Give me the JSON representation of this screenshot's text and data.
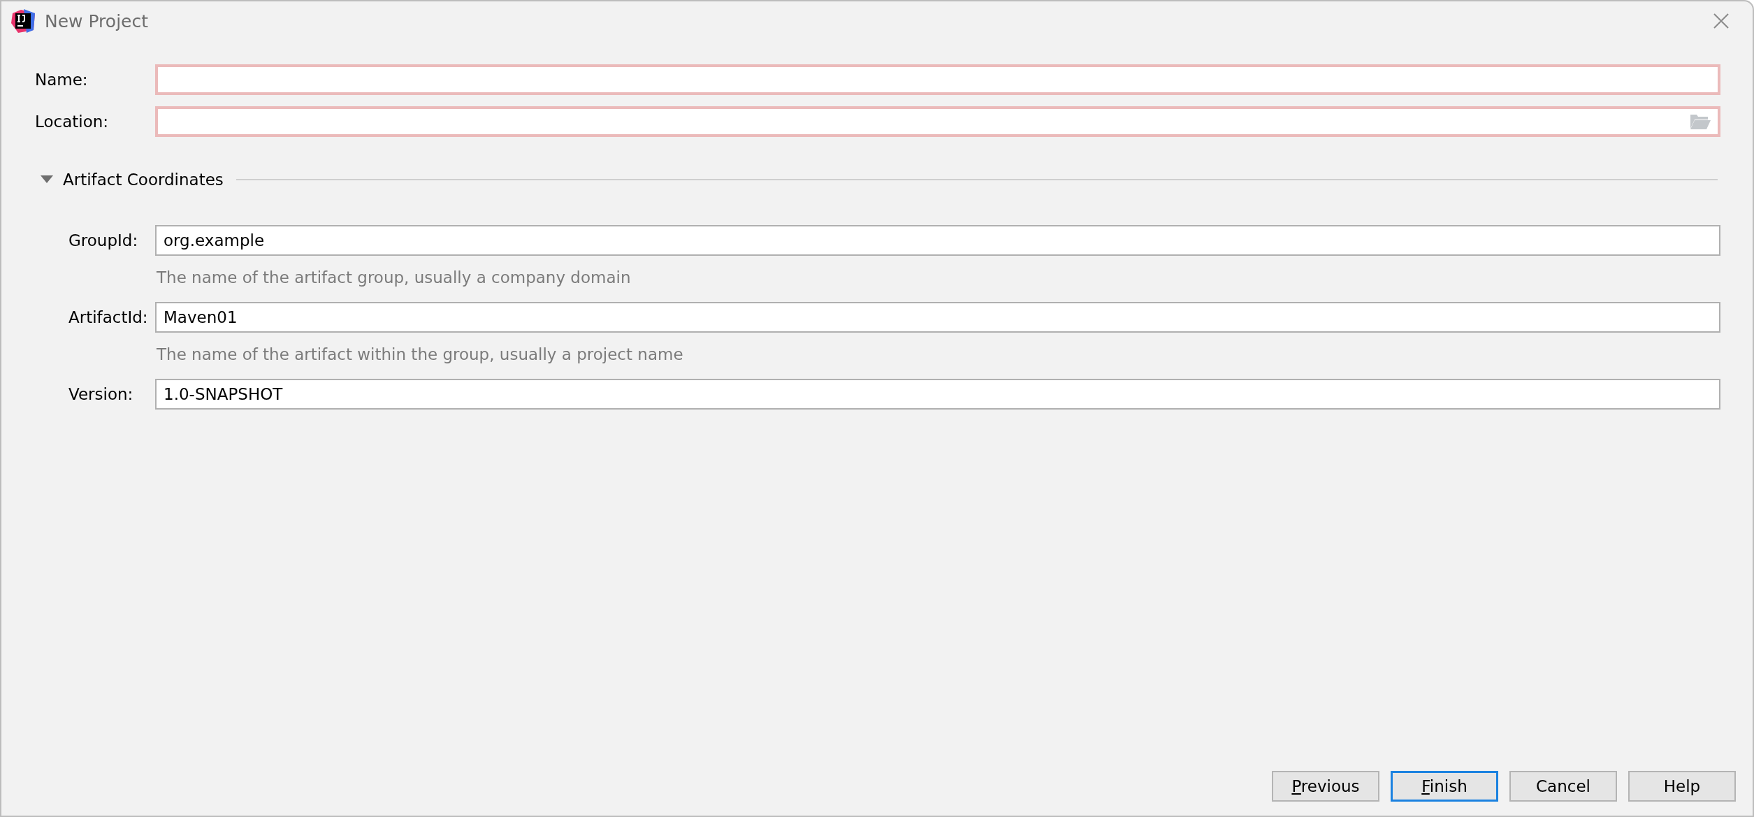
{
  "window": {
    "title": "New Project"
  },
  "fields": [
    {
      "label": "Name:",
      "error": true,
      "browse": false
    },
    {
      "label": "Location:",
      "error": true,
      "browse": true
    }
  ],
  "section": {
    "title": "Artifact Coordinates",
    "expanded": true,
    "fields": [
      {
        "label": "GroupId:",
        "value": "org.example",
        "hint": "The name of the artifact group, usually a company domain"
      },
      {
        "label": "ArtifactId:",
        "value": "Maven01",
        "hint": "The name of the artifact within the group, usually a project name"
      },
      {
        "label": "Version:",
        "value": "1.0-SNAPSHOT"
      }
    ]
  },
  "buttons": [
    {
      "label": "Previous",
      "default": false,
      "mnemonic": true
    },
    {
      "label": "Finish",
      "default": true,
      "mnemonic": true
    },
    {
      "label": "Cancel",
      "default": false,
      "mnemonic": false
    },
    {
      "label": "Help",
      "default": false,
      "mnemonic": false
    }
  ]
}
